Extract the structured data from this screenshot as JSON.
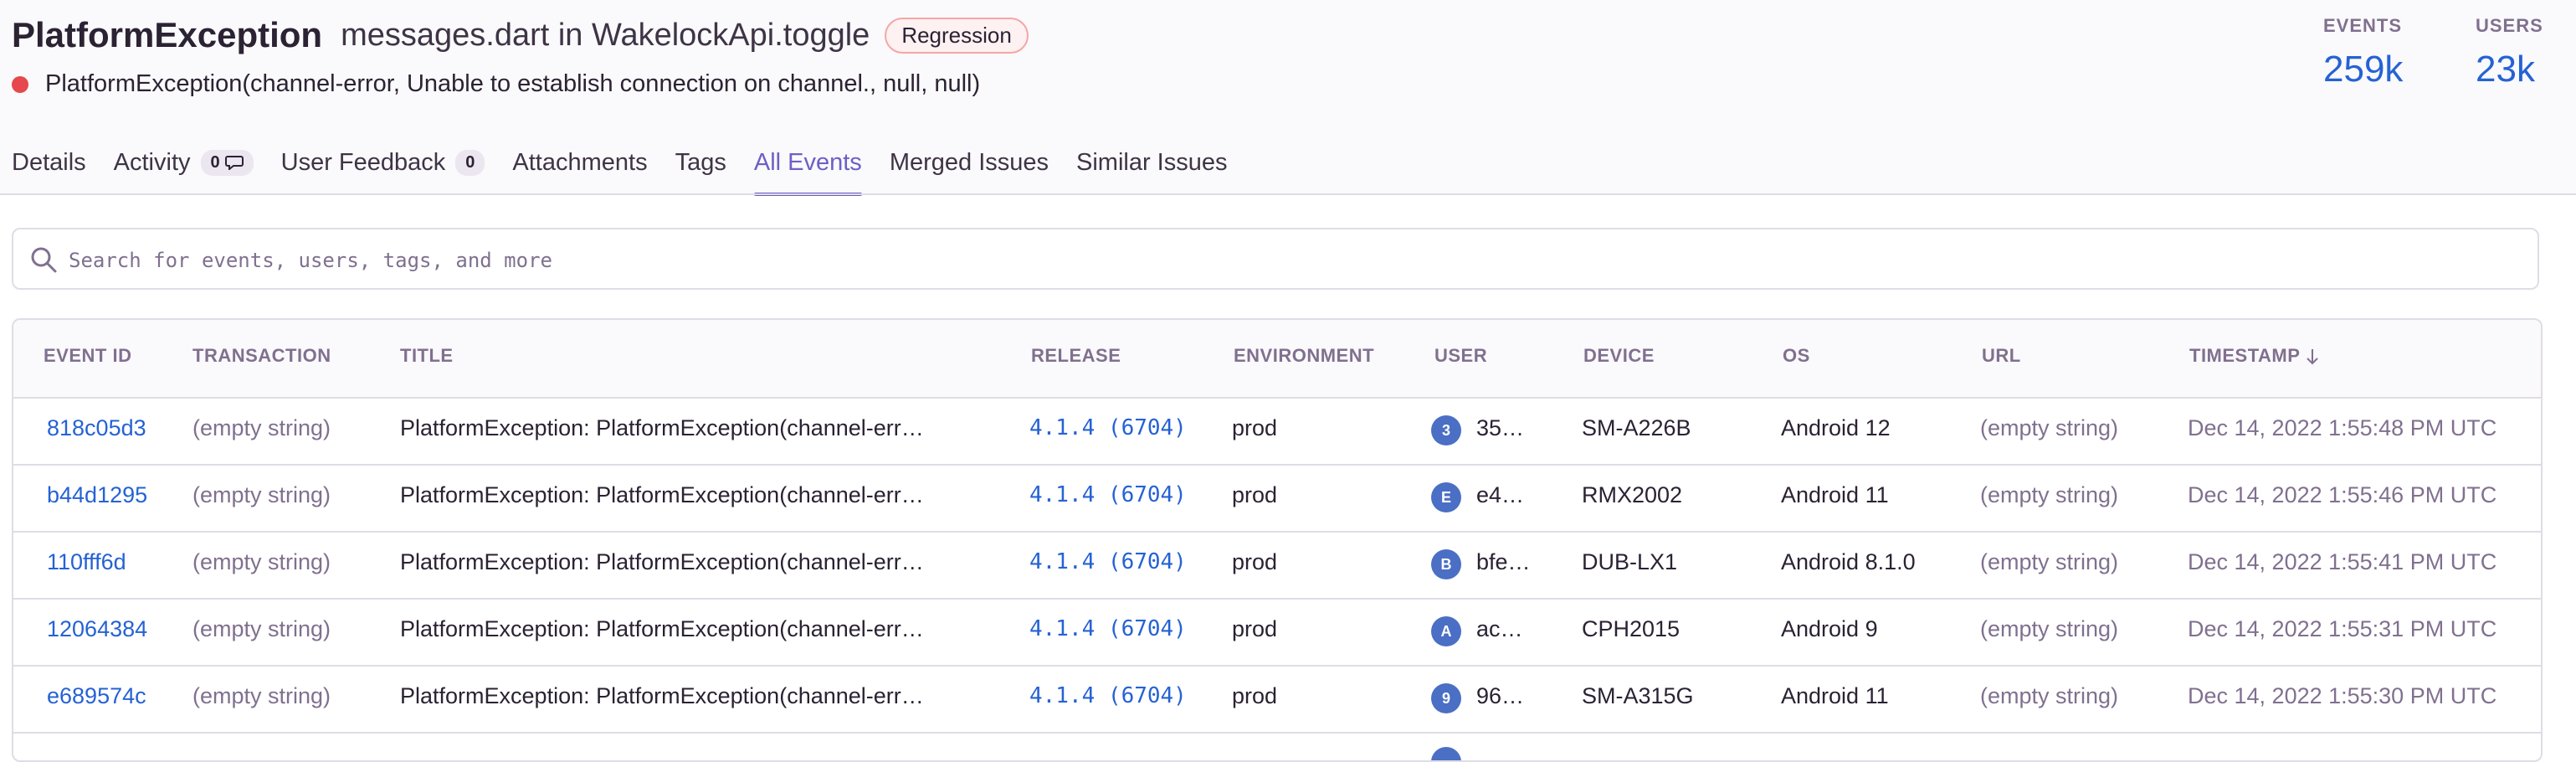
{
  "issue": {
    "title": "PlatformException",
    "culprit": "messages.dart in WakelockApi.toggle",
    "badge": "Regression",
    "message": "PlatformException(channel-error, Unable to establish connection on channel., null, null)"
  },
  "stats": {
    "events_label": "EVENTS",
    "events_value": "259k",
    "users_label": "USERS",
    "users_value": "23k"
  },
  "tabs": [
    {
      "label": "Details"
    },
    {
      "label": "Activity",
      "count": "0"
    },
    {
      "label": "User Feedback",
      "count": "0"
    },
    {
      "label": "Attachments"
    },
    {
      "label": "Tags"
    },
    {
      "label": "All Events",
      "active": true
    },
    {
      "label": "Merged Issues"
    },
    {
      "label": "Similar Issues"
    }
  ],
  "search": {
    "placeholder": "Search for events, users, tags, and more",
    "icon": "search-icon"
  },
  "table": {
    "columns": [
      "EVENT ID",
      "TRANSACTION",
      "TITLE",
      "RELEASE",
      "ENVIRONMENT",
      "USER",
      "DEVICE",
      "OS",
      "URL",
      "TIMESTAMP"
    ],
    "rows": [
      {
        "event_id": "818c05d3",
        "transaction": "(empty string)",
        "title": "PlatformException: PlatformException(channel-err…",
        "release": "4.1.4 (6704)",
        "environment": "prod",
        "user_initial": "3",
        "user": "35…",
        "device": "SM-A226B",
        "os": "Android 12",
        "url": "(empty string)",
        "timestamp": "Dec 14, 2022 1:55:48 PM UTC"
      },
      {
        "event_id": "b44d1295",
        "transaction": "(empty string)",
        "title": "PlatformException: PlatformException(channel-err…",
        "release": "4.1.4 (6704)",
        "environment": "prod",
        "user_initial": "E",
        "user": "e4…",
        "device": "RMX2002",
        "os": "Android 11",
        "url": "(empty string)",
        "timestamp": "Dec 14, 2022 1:55:46 PM UTC"
      },
      {
        "event_id": "110fff6d",
        "transaction": "(empty string)",
        "title": "PlatformException: PlatformException(channel-err…",
        "release": "4.1.4 (6704)",
        "environment": "prod",
        "user_initial": "B",
        "user": "bfe…",
        "device": "DUB-LX1",
        "os": "Android 8.1.0",
        "url": "(empty string)",
        "timestamp": "Dec 14, 2022 1:55:41 PM UTC"
      },
      {
        "event_id": "12064384",
        "transaction": "(empty string)",
        "title": "PlatformException: PlatformException(channel-err…",
        "release": "4.1.4 (6704)",
        "environment": "prod",
        "user_initial": "A",
        "user": "ac…",
        "device": "CPH2015",
        "os": "Android 9",
        "url": "(empty string)",
        "timestamp": "Dec 14, 2022 1:55:31 PM UTC"
      },
      {
        "event_id": "e689574c",
        "transaction": "(empty string)",
        "title": "PlatformException: PlatformException(channel-err…",
        "release": "4.1.4 (6704)",
        "environment": "prod",
        "user_initial": "9",
        "user": "96…",
        "device": "SM-A315G",
        "os": "Android 11",
        "url": "(empty string)",
        "timestamp": "Dec 14, 2022 1:55:30 PM UTC"
      }
    ]
  },
  "colors": {
    "accent": "#6c5fc7",
    "link": "#2562d4",
    "error_dot": "#e5484d",
    "avatar": "#4a6fc4"
  }
}
